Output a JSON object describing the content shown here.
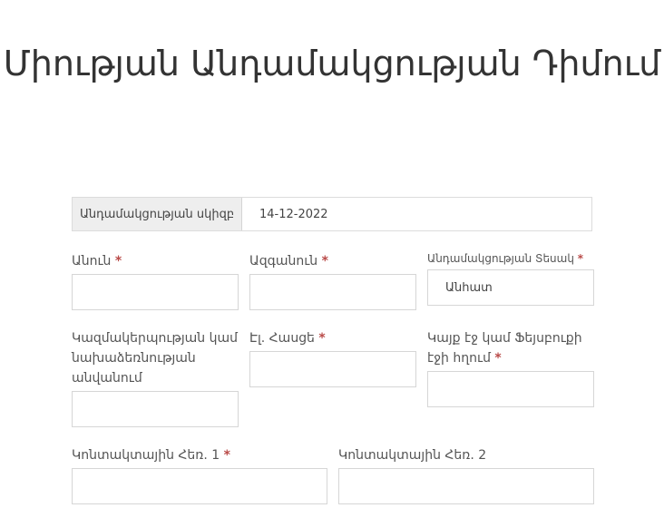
{
  "title": "Միության Անդամակցության Դիմում",
  "membership_date": {
    "label": "Անդամակցության սկիզբ",
    "value": "14-12-2022"
  },
  "fields": {
    "first_name": {
      "label": "Անուն",
      "required": "*"
    },
    "last_name": {
      "label": "Ազգանուն",
      "required": "*"
    },
    "membership_type": {
      "label": "Անդամակցության Տեսակ",
      "required": "*",
      "value": "Անհատ"
    },
    "organization": {
      "label": "Կազմակերպության կամ նախաձեռնության անվանում"
    },
    "email": {
      "label": "Էլ. Հասցե",
      "required": "*"
    },
    "website": {
      "label": "Կայք էջ կամ Ֆեյսբուքի էջի հղում",
      "required": "*"
    },
    "phone1": {
      "label": "Կոնտակտային Հեռ. 1",
      "required": "*"
    },
    "phone2": {
      "label": "Կոնտակտային Հեռ. 2"
    }
  }
}
